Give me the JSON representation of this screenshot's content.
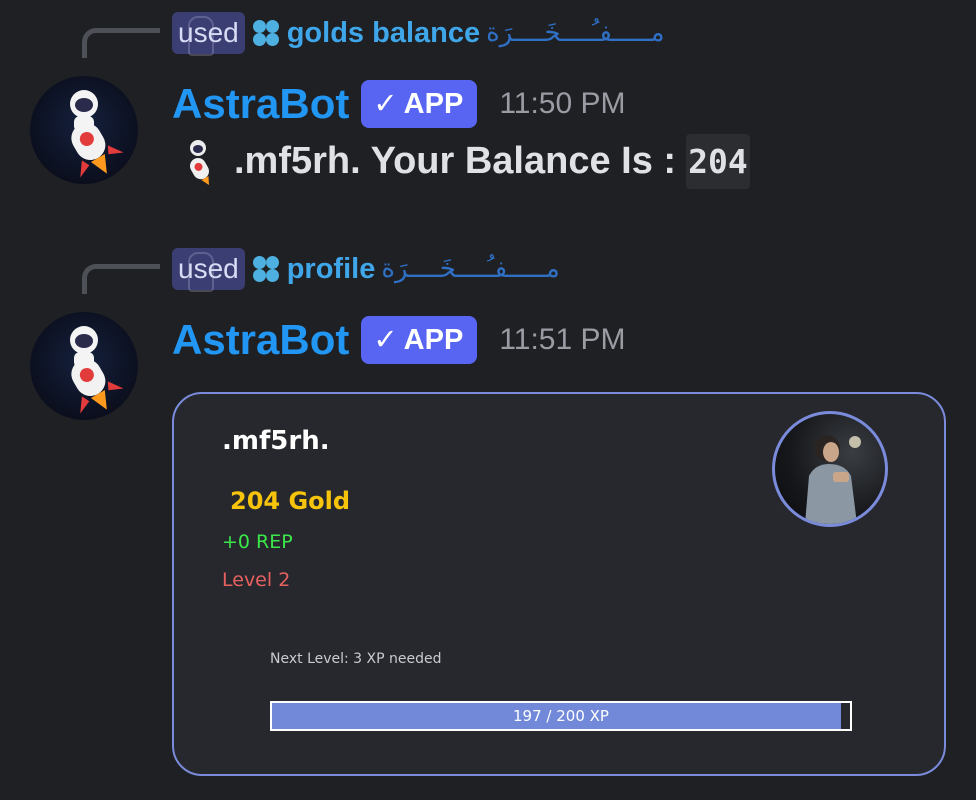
{
  "messages": [
    {
      "reply": {
        "chip": "used",
        "command": "golds balance",
        "arabic": "مـــــفـُــــخَــــرَة"
      },
      "author": "AstraBot",
      "badge": "APP",
      "badge_check": "✓",
      "time": "11:50 PM",
      "content": {
        "prefix": ".mf5rh. Your Balance Is :",
        "code": "204"
      }
    },
    {
      "reply": {
        "chip": "used",
        "command": "profile",
        "arabic": "مـــــفـُــــخَــــرَة"
      },
      "author": "AstraBot",
      "badge": "APP",
      "badge_check": "✓",
      "time": "11:51 PM"
    }
  ],
  "embed": {
    "username": ".mf5rh.",
    "gold": "204 Gold",
    "rep": "+0 REP",
    "level": "Level 2",
    "next_level": "Next Level: 3 XP needed",
    "xp_text": "197 / 200 XP",
    "xp_progress": 0.985
  },
  "icons": {
    "reply_command_icon": "four-dot-clover-icon",
    "avatar": "astronaut-rocket-icon",
    "inline_emoji": "astronaut-rocket-icon",
    "verified": "checkmark-icon"
  },
  "colors": {
    "background": "#1f2024",
    "author": "#2196f3",
    "badge": "#5865f2",
    "gold": "#f6c40b",
    "rep": "#3be84a",
    "level": "#e66060",
    "embed_border": "#7b8bdb",
    "xp_fill": "#7289da"
  }
}
